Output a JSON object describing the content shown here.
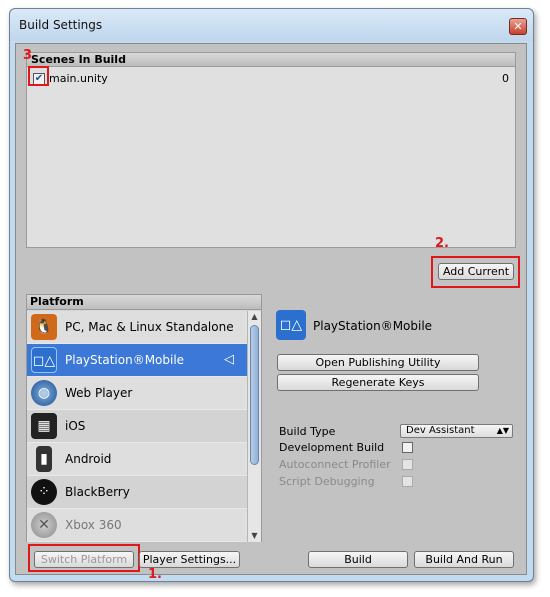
{
  "window": {
    "title": "Build Settings"
  },
  "scenes": {
    "header": "Scenes In Build",
    "items": [
      {
        "name": "main.unity",
        "index": "0",
        "checked": true
      }
    ]
  },
  "annotations": {
    "one": "1.",
    "two": "2.",
    "three": "3"
  },
  "buttons": {
    "add_current": "Add Current",
    "switch_platform": "Switch Platform",
    "player_settings": "Player Settings...",
    "build": "Build",
    "build_and_run": "Build And Run",
    "open_publishing": "Open Publishing Utility",
    "regenerate_keys": "Regenerate Keys"
  },
  "platform": {
    "header": "Platform",
    "items": [
      {
        "label": "PC, Mac & Linux Standalone",
        "icon": "pc-mac-linux-icon"
      },
      {
        "label": "PlayStation®Mobile",
        "icon": "playstation-mobile-icon",
        "selected": true
      },
      {
        "label": "Web Player",
        "icon": "web-player-globe-icon"
      },
      {
        "label": "iOS",
        "icon": "ios-device-icon"
      },
      {
        "label": "Android",
        "icon": "android-phone-icon"
      },
      {
        "label": "BlackBerry",
        "icon": "blackberry-icon"
      },
      {
        "label": "Xbox 360",
        "icon": "xbox-360-icon",
        "disabled": true
      }
    ]
  },
  "selected_platform": {
    "title": "PlayStation®Mobile"
  },
  "settings": {
    "build_type_label": "Build Type",
    "build_type_value": "Dev Assistant",
    "development_build_label": "Development Build",
    "autoconnect_profiler_label": "Autoconnect Profiler",
    "script_debugging_label": "Script Debugging"
  },
  "colors": {
    "selection": "#3b78d8",
    "annotation": "#e0171b",
    "panel": "#c2c2c2"
  }
}
